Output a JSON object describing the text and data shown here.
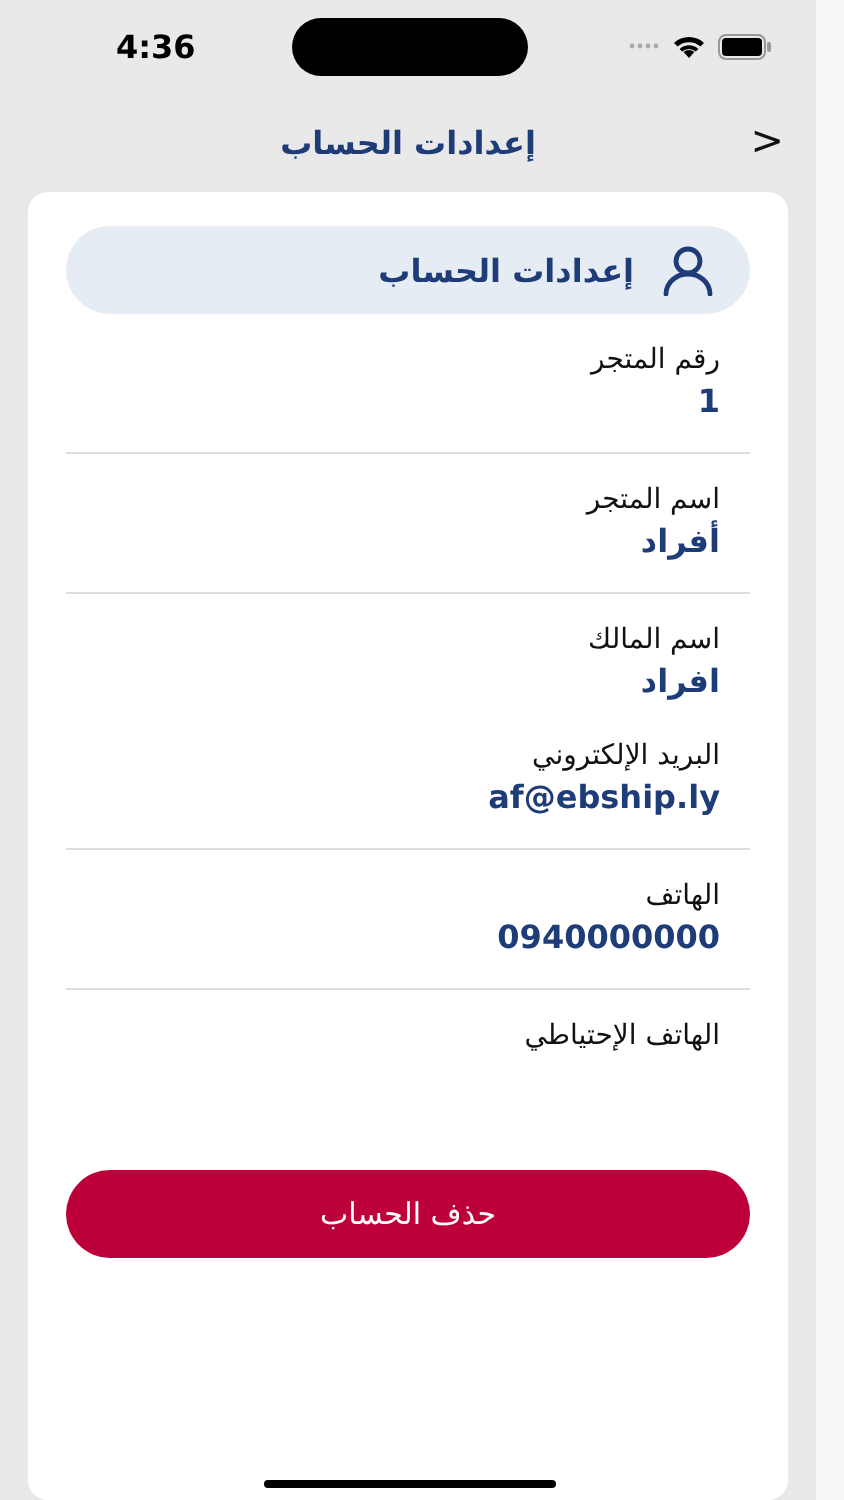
{
  "status_bar": {
    "time": "4:36"
  },
  "nav": {
    "title": "إعدادات الحساب",
    "back": ">"
  },
  "section_header": {
    "title": "إعدادات الحساب"
  },
  "sections": [
    {
      "fields": [
        {
          "label": "رقم المتجر",
          "value": "1"
        }
      ]
    },
    {
      "fields": [
        {
          "label": "اسم المتجر",
          "value": "أفراد"
        }
      ]
    },
    {
      "fields": [
        {
          "label": "اسم المالك",
          "value": "افراد"
        },
        {
          "label": "البريد الإلكتروني",
          "value": "af@ebship.ly"
        }
      ]
    },
    {
      "fields": [
        {
          "label": "الهاتف",
          "value": "0940000000"
        }
      ]
    },
    {
      "fields": [
        {
          "label": "الهاتف الإحتياطي"
        }
      ]
    }
  ],
  "delete_button": "حذف الحساب"
}
